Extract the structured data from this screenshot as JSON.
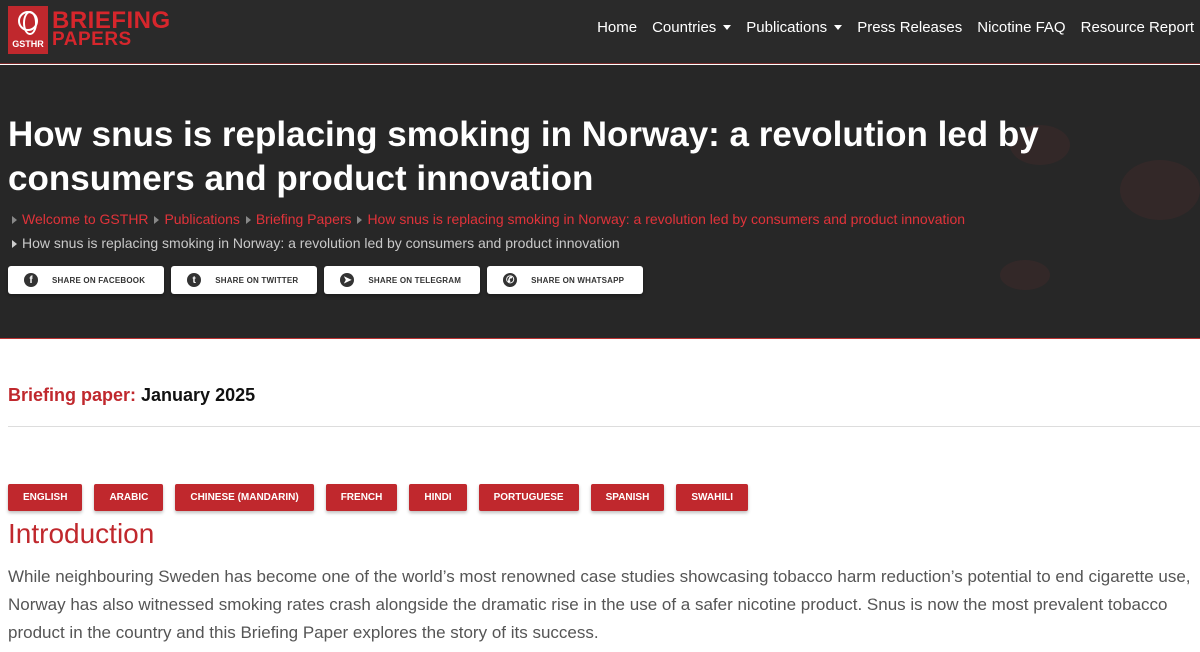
{
  "logo": {
    "mark_text": "GSTHR",
    "line1": "BRIEFING",
    "line2": "PAPERS"
  },
  "nav": [
    {
      "label": "Home",
      "dropdown": false
    },
    {
      "label": "Countries",
      "dropdown": true
    },
    {
      "label": "Publications",
      "dropdown": true
    },
    {
      "label": "Press Releases",
      "dropdown": false
    },
    {
      "label": "Nicotine FAQ",
      "dropdown": false
    },
    {
      "label": "Resource Report",
      "dropdown": false
    }
  ],
  "hero": {
    "title": "How snus is replacing smoking in Norway: a revolution led by consumers and product innovation",
    "breadcrumbs": [
      "Welcome to GSTHR",
      "Publications",
      "Briefing Papers",
      "How snus is replacing smoking in Norway: a revolution led by consumers and product innovation"
    ],
    "current": "How snus is replacing smoking in Norway: a revolution led by consumers and product innovation"
  },
  "share": [
    {
      "label": "SHARE ON FACEBOOK",
      "icon": "facebook-icon",
      "glyph": "f"
    },
    {
      "label": "SHARE ON TWITTER",
      "icon": "twitter-icon",
      "glyph": "t"
    },
    {
      "label": "SHARE ON TELEGRAM",
      "icon": "telegram-icon",
      "glyph": "➤"
    },
    {
      "label": "SHARE ON WHATSAPP",
      "icon": "whatsapp-icon",
      "glyph": "✆"
    }
  ],
  "paper": {
    "key": "Briefing paper:",
    "value": "January 2025"
  },
  "languages": [
    "ENGLISH",
    "ARABIC",
    "CHINESE (MANDARIN)",
    "FRENCH",
    "HINDI",
    "PORTUGUESE",
    "SPANISH",
    "SWAHILI"
  ],
  "intro": {
    "heading": "Introduction",
    "text": "While neighbouring Sweden has become one of the world’s most renowned case studies showcasing tobacco harm reduction’s potential to end cigarette use, Norway has also witnessed smoking rates crash alongside the dramatic rise in the use of a safer nicotine product. Snus is now the most prevalent tobacco product in the country and this Briefing Paper explores the story of its success."
  },
  "colors": {
    "brand_red": "#c0282d",
    "dark_bg": "#272727"
  }
}
